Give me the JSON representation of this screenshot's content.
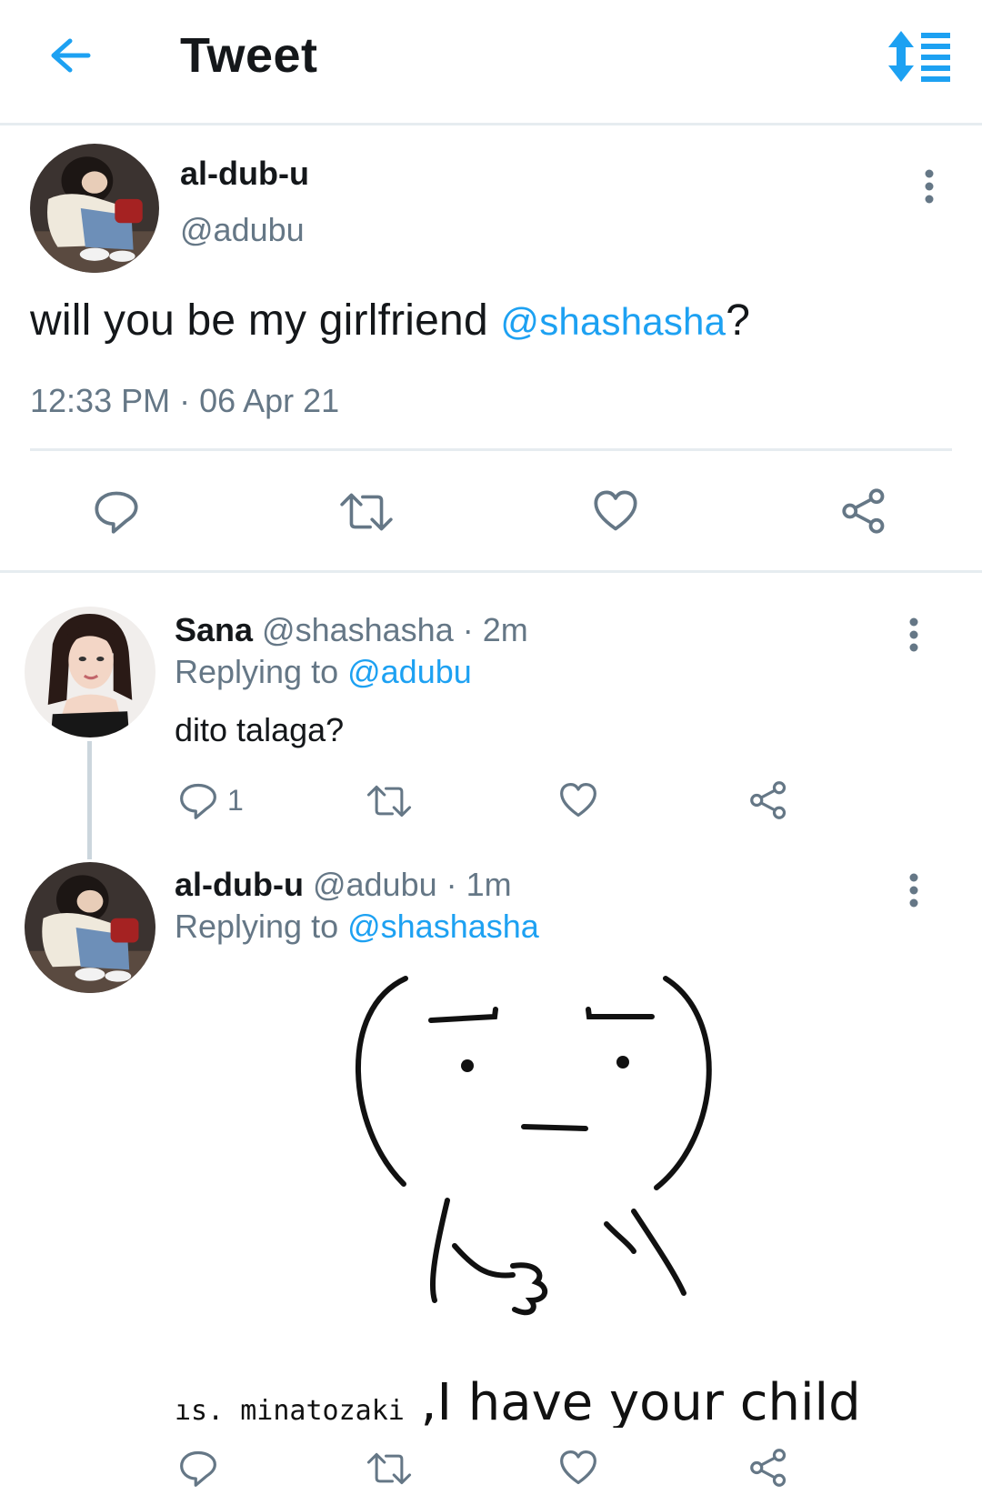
{
  "header": {
    "title": "Tweet"
  },
  "main_tweet": {
    "name": "al-dub-u",
    "handle": "@adubu",
    "text_before": "will you be my girlfriend ",
    "mention": "@shashasha",
    "text_after": "?",
    "timestamp": "12:33 PM · 06 Apr 21"
  },
  "replies": [
    {
      "name": "Sana",
      "meta": " @shashasha · 2m",
      "replying_label": "Replying to ",
      "replying_handle": "@adubu",
      "text": "dito talaga?",
      "reply_count": "1"
    },
    {
      "name": "al-dub-u",
      "meta": " @adubu · 1m",
      "replying_label": "Replying to ",
      "replying_handle": "@shashasha",
      "image_caption_small": "ıs. minatozaki",
      "image_caption_big": " ,I have your child"
    }
  ],
  "colors": {
    "accent": "#1da1f2",
    "secondary_text": "#657786",
    "divider": "#e6ecf0"
  },
  "icons": [
    "back-arrow-icon",
    "sort-icon",
    "more-vertical-icon",
    "reply-icon",
    "retweet-icon",
    "like-icon",
    "share-icon"
  ]
}
